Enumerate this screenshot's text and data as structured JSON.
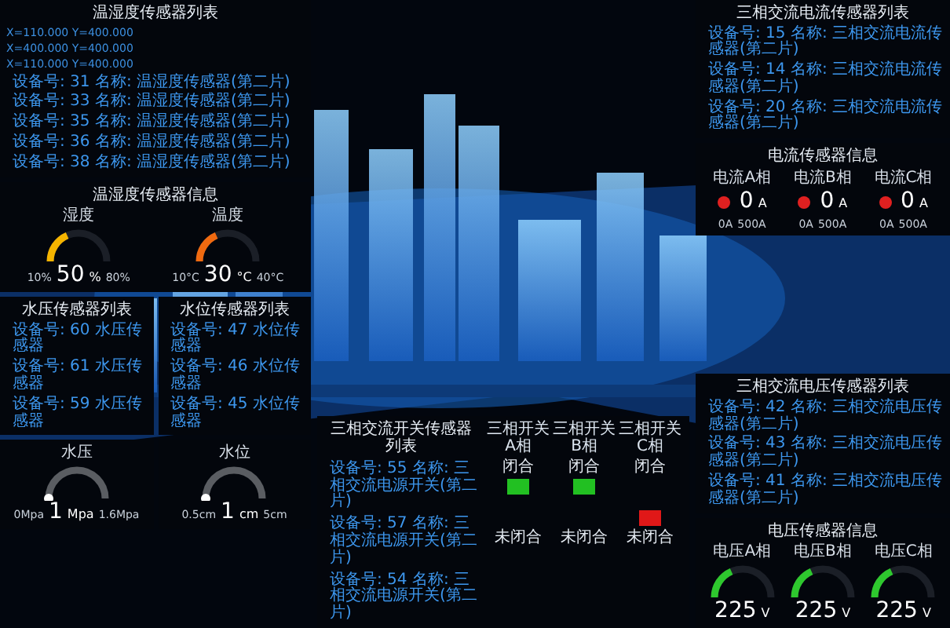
{
  "temp_humidity_list": {
    "title": "温湿度传感器列表",
    "coordinates": [
      "X=110.000 Y=400.000",
      "X=400.000 Y=400.000",
      "X=110.000 Y=400.000"
    ],
    "rows": [
      "设备号: 31 名称: 温湿度传感器(第二片)",
      "设备号: 33 名称: 温湿度传感器(第二片)",
      "设备号: 35 名称: 温湿度传感器(第二片)",
      "设备号: 36 名称: 温湿度传感器(第二片)",
      "设备号: 38 名称: 温湿度传感器(第二片)"
    ]
  },
  "temp_humidity_info": {
    "title": "温湿度传感器信息",
    "gauges": [
      {
        "kind": "arc",
        "label": "湿度",
        "value": "50",
        "unit": "%",
        "min": "10%",
        "max": "80%",
        "level": 0.3,
        "color": "#f5b400"
      },
      {
        "kind": "arc",
        "label": "温度",
        "value": "30",
        "unit": "°C",
        "min": "10°C",
        "max": "40°C",
        "level": 0.3,
        "color": "#f06a10"
      }
    ]
  },
  "water_lists": [
    {
      "title": "水压传感器列表",
      "rows": [
        "设备号: 60 水压传感器",
        "设备号: 61 水压传感器",
        "设备号: 59 水压传感器"
      ]
    },
    {
      "title": "水位传感器列表",
      "rows": [
        "设备号: 47 水位传感器",
        "设备号: 46 水位传感器",
        "设备号: 45 水位传感器"
      ]
    }
  ],
  "water_gauges": [
    {
      "kind": "knob",
      "label": "水压",
      "value": "1",
      "unit": "Mpa",
      "min": "0Mpa",
      "max": "1.6Mpa",
      "level": 0
    },
    {
      "kind": "knob",
      "label": "水位",
      "value": "1",
      "unit": "cm",
      "min": "0.5cm",
      "max": "5cm",
      "level": 0
    }
  ],
  "switch_list": {
    "title": "三相交流开关传感器列表",
    "rows": [
      "设备号: 55 名称: 三相交流电源开关(第二片)",
      "设备号: 57 名称: 三相交流电源开关(第二片)",
      "设备号: 54 名称: 三相交流电源开关(第二片)"
    ]
  },
  "switches": [
    {
      "label": "三相开关 A相",
      "closed_label": "闭合",
      "open_label": "未闭合",
      "closed": true
    },
    {
      "label": "三相开关 B相",
      "closed_label": "闭合",
      "open_label": "未闭合",
      "closed": true
    },
    {
      "label": "三相开关 C相",
      "closed_label": "闭合",
      "open_label": "未闭合",
      "closed": false
    }
  ],
  "current_list": {
    "title": "三相交流电流传感器列表",
    "rows": [
      "设备号: 15 名称: 三相交流电流传感器(第二片)",
      "设备号: 14 名称: 三相交流电流传感器(第二片)",
      "设备号: 20 名称: 三相交流电流传感器(第二片)"
    ]
  },
  "current_info": {
    "title": "电流传感器信息",
    "phases": [
      {
        "label": "电流A相",
        "value": "0",
        "unit": "A",
        "min": "0A",
        "max": "500A",
        "color": "#e02020"
      },
      {
        "label": "电流B相",
        "value": "0",
        "unit": "A",
        "min": "0A",
        "max": "500A",
        "color": "#e02020"
      },
      {
        "label": "电流C相",
        "value": "0",
        "unit": "A",
        "min": "0A",
        "max": "500A",
        "color": "#e02020"
      }
    ]
  },
  "voltage_list": {
    "title": "三相交流电压传感器列表",
    "rows": [
      "设备号: 42 名称: 三相交流电压传感器(第二片)",
      "设备号: 43 名称: 三相交流电压传感器(第二片)",
      "设备号: 41 名称: 三相交流电压传感器(第二片)"
    ]
  },
  "voltage_info": {
    "title": "电压传感器信息",
    "gauges": [
      {
        "kind": "arc",
        "label": "电压A相",
        "value": "225",
        "unit": "V",
        "level": 0.3,
        "color": "#2ec82e"
      },
      {
        "kind": "arc",
        "label": "电压B相",
        "value": "225",
        "unit": "V",
        "level": 0.3,
        "color": "#2ec82e"
      },
      {
        "kind": "arc",
        "label": "电压C相",
        "value": "225",
        "unit": "V",
        "level": 0.3,
        "color": "#2ec82e"
      }
    ]
  }
}
